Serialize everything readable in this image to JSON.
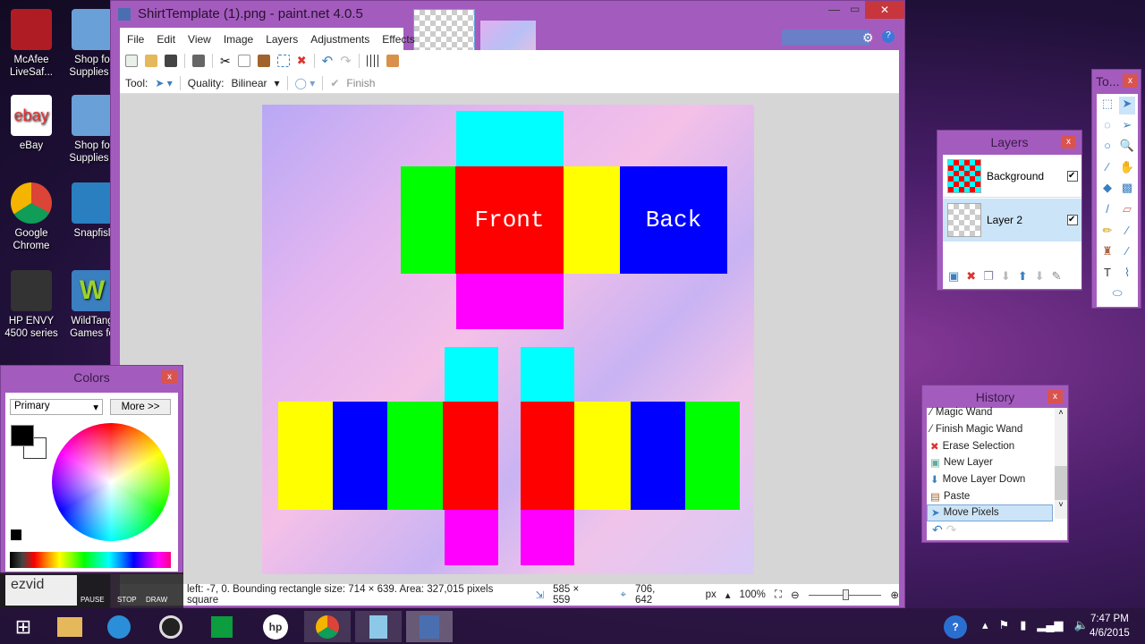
{
  "desktop": {
    "icons": [
      {
        "label": "McAfee LiveSaf...",
        "color": "#b01c24"
      },
      {
        "label": "Shop fo Supplies -",
        "color": "#6aa0d8"
      },
      {
        "label": "eBay",
        "color": "#ffffff"
      },
      {
        "label": "Shop fo Supplies -",
        "color": "#6aa0d8"
      },
      {
        "label": "Google Chrome",
        "color": "#db4437"
      },
      {
        "label": "Snapfisl",
        "color": "#2a7fc0"
      },
      {
        "label": "HP ENVY 4500 series",
        "color": "#333333"
      },
      {
        "label": "WildTang Games fo",
        "color": "#3a7fc0"
      }
    ]
  },
  "window": {
    "title": "ShirtTemplate (1).png - paint.net 4.0.5",
    "menu": [
      "File",
      "Edit",
      "View",
      "Image",
      "Layers",
      "Adjustments",
      "Effects"
    ],
    "tool_options": {
      "tool_label": "Tool:",
      "quality_label": "Quality:",
      "quality_value": "Bilinear",
      "finish": "Finish"
    },
    "canvas": {
      "front_label": "Front",
      "back_label": "Back"
    },
    "status": {
      "selection": "left: -7, 0. Bounding rectangle size: 714 × 639. Area: 327,015 pixels square",
      "size": "585 × 559",
      "cursor": "706, 642",
      "units": "px",
      "zoom": "100%"
    }
  },
  "colors_panel": {
    "title": "Colors",
    "mode": "Primary",
    "more": "More >>",
    "primary": "#000000",
    "secondary": "#ffffff"
  },
  "layers_panel": {
    "title": "Layers",
    "layers": [
      {
        "name": "Background",
        "visible": true
      },
      {
        "name": "Layer 2",
        "visible": true,
        "selected": true
      }
    ]
  },
  "tools_panel": {
    "title": "To..."
  },
  "history_panel": {
    "title": "History",
    "items": [
      {
        "label": "Magic Wand",
        "icon": "magic-wand-icon"
      },
      {
        "label": "Finish Magic Wand",
        "icon": "magic-wand-icon"
      },
      {
        "label": "Erase Selection",
        "icon": "red-x-icon"
      },
      {
        "label": "New Layer",
        "icon": "new-layer-icon"
      },
      {
        "label": "Move Layer Down",
        "icon": "arrow-down-icon"
      },
      {
        "label": "Paste",
        "icon": "paste-icon"
      },
      {
        "label": "Move Pixels",
        "icon": "move-pixels-icon",
        "selected": true
      }
    ]
  },
  "ezvid": {
    "logo": "ezvid RECORDER",
    "buttons": [
      "PAUSE",
      "STOP",
      "DRAW"
    ]
  },
  "taskbar": {
    "time": "7:47 PM",
    "date": "4/6/2015"
  }
}
